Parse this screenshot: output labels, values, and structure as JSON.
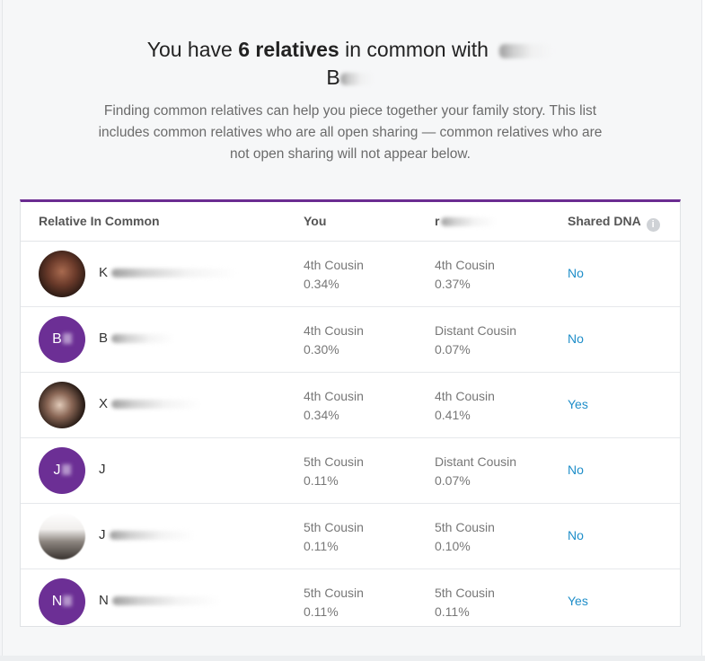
{
  "header": {
    "prefix": "You have ",
    "count_phrase": "6 relatives",
    "suffix": " in common with",
    "name_visible_start": "B"
  },
  "description": "Finding common relatives can help you piece together your family story. This list includes common relatives who are all open sharing — common relatives who are not open sharing will not appear below.",
  "table": {
    "headers": {
      "relative": "Relative In Common",
      "you": "You",
      "match": "r",
      "shared": "Shared DNA"
    },
    "rows": [
      {
        "avatar": "photo",
        "initial": "",
        "name": "K",
        "you_rel": "4th Cousin",
        "you_pct": "0.34%",
        "match_rel": "4th Cousin",
        "match_pct": "0.37%",
        "shared": "No"
      },
      {
        "avatar": "initials",
        "initial": "B",
        "name": "B",
        "you_rel": "4th Cousin",
        "you_pct": "0.30%",
        "match_rel": "Distant Cousin",
        "match_pct": "0.07%",
        "shared": "No"
      },
      {
        "avatar": "photo",
        "initial": "",
        "name": "X",
        "you_rel": "4th Cousin",
        "you_pct": "0.34%",
        "match_rel": "4th Cousin",
        "match_pct": "0.41%",
        "shared": "Yes"
      },
      {
        "avatar": "initials",
        "initial": "J",
        "name": "J",
        "you_rel": "5th Cousin",
        "you_pct": "0.11%",
        "match_rel": "Distant Cousin",
        "match_pct": "0.07%",
        "shared": "No"
      },
      {
        "avatar": "photo",
        "initial": "",
        "name": "J",
        "you_rel": "5th Cousin",
        "you_pct": "0.11%",
        "match_rel": "5th Cousin",
        "match_pct": "0.10%",
        "shared": "No"
      },
      {
        "avatar": "initials",
        "initial": "N",
        "name": "N",
        "you_rel": "5th Cousin",
        "you_pct": "0.11%",
        "match_rel": "5th Cousin",
        "match_pct": "0.11%",
        "shared": "Yes"
      }
    ]
  },
  "colors": {
    "accent": "#6b2c91",
    "link": "#1f8ec9"
  }
}
